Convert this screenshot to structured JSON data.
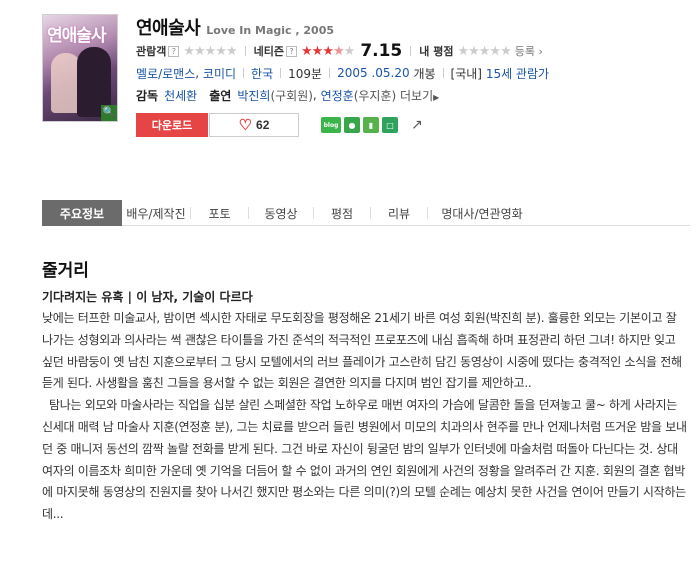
{
  "movie": {
    "title": "연애술사",
    "subtitle": "Love In Magic , 2005",
    "poster_title": "연애술사"
  },
  "ratings": {
    "audience_label": "관람객",
    "netizen_label": "네티즌",
    "netizen_score": "7.15",
    "my_rating_label": "내 평점",
    "register_label": "등록",
    "help_icon_text": "?"
  },
  "meta": {
    "genre1": "멜로/로맨스",
    "genre_sep": ",",
    "genre2": "코미디",
    "country": "한국",
    "runtime": "109분",
    "release_date": "2005 .05.20",
    "release_suffix": "개봉",
    "rating_prefix": "[국내]",
    "age_rating": "15세 관람가"
  },
  "credits": {
    "director_label": "감독",
    "director": "천세환",
    "cast_label": "출연",
    "actor1": "박진희",
    "role1": "(구회원)",
    "actor_sep": ",",
    "actor2": "연정훈",
    "role2": "(우지훈)",
    "more_label": "더보기"
  },
  "actions": {
    "download_label": "다운로드",
    "like_count": "62",
    "blog_label": "blog"
  },
  "tabs": [
    {
      "label": "주요정보"
    },
    {
      "label": "배우/제작진"
    },
    {
      "label": "포토"
    },
    {
      "label": "동영상"
    },
    {
      "label": "평점"
    },
    {
      "label": "리뷰"
    },
    {
      "label": "명대사/연관영화"
    }
  ],
  "synopsis": {
    "section_title": "줄거리",
    "tagline": "기다려지는 유혹 | 이 남자, 기술이 다르다",
    "body": "낮에는 터프한 미술교사, 밤이면 섹시한 자태로 무도회장을 평정해온 21세기 바른 여성 회원(박진희 분). 훌륭한 외모는 기본이고 잘 나가는 성형외과 의사라는 썩 괜찮은 타이틀을 가진 준석의 적극적인 프로포즈에 내심 흡족해 하며 표정관리 하던 그녀! 하지만 잊고 싶던 바람둥이 옛 남친 지훈으로부터 그 당시 모텔에서의 러브 플레이가 고스란히 담긴 동영상이 시중에 떴다는 충격적인 소식을 전해 듣게 된다. 사생활을 훔친 그들을 용서할 수 없는 회원은 결연한 의지를 다지며 범인 잡기를 제안하고..\n  탐나는 외모와 마술사라는 직업을 십분 살린 스페셜한 작업 노하우로 매번 여자의 가슴에 달콤한 돌을 던져놓고 쿨~ 하게 사라지는 신세대 매력 남 마술사 지훈(연정훈 분), 그는 치료를 받으러 들린 병원에서 미모의 치과의사 현주를 만나 언제나처럼 뜨거운 밤을 보내던 중 매니저 동선의 깜짝 놀랄 전화를 받게 된다. 그건 바로 자신이 뒹굴던 밤의 일부가 인터넷에 마술처럼 떠돌아 다닌다는 것. 상대여자의 이름조차 희미한 가운데 옛 기억을 더듬어 할 수 없이 과거의 연인 회원에게 사건의 정황을 알려주러 간 지훈. 회원의 결혼 협박에 마지못해 동영상의 진원지를 찾아 나서긴 했지만 평소와는 다른 의미(?)의 모텔 순례는 예상치 못한 사건을 연이어 만들기 시작하는데..."
  },
  "colors": {
    "accent_red": "#e64545",
    "link_blue": "#1a55a6",
    "tab_active_bg": "#6b6b6b"
  },
  "star_values": {
    "audience": 0,
    "netizen": 3.5,
    "my": 0
  }
}
